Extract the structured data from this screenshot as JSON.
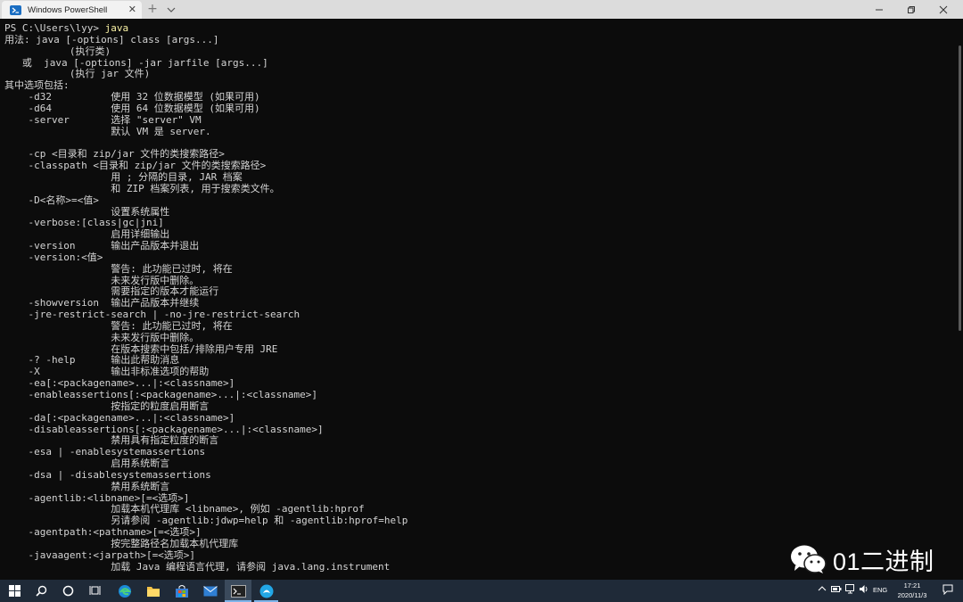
{
  "window": {
    "tab_title": "Windows PowerShell",
    "tab_close_glyph": "✕",
    "new_tab_glyph": "+",
    "icons": [
      "powershell-icon",
      "chevron-down-icon",
      "minimize-icon",
      "maximize-icon",
      "close-icon"
    ]
  },
  "terminal": {
    "prompt": "PS C:\\Users\\lyy> ",
    "command": "java",
    "lines": [
      "用法: java [-options] class [args...]",
      "           (执行类)",
      "   或  java [-options] -jar jarfile [args...]",
      "           (执行 jar 文件)",
      "其中选项包括:",
      "    -d32          使用 32 位数据模型 (如果可用)",
      "    -d64          使用 64 位数据模型 (如果可用)",
      "    -server       选择 \"server\" VM",
      "                  默认 VM 是 server.",
      "",
      "    -cp <目录和 zip/jar 文件的类搜索路径>",
      "    -classpath <目录和 zip/jar 文件的类搜索路径>",
      "                  用 ; 分隔的目录, JAR 档案",
      "                  和 ZIP 档案列表, 用于搜索类文件。",
      "    -D<名称>=<值>",
      "                  设置系统属性",
      "    -verbose:[class|gc|jni]",
      "                  启用详细输出",
      "    -version      输出产品版本并退出",
      "    -version:<值>",
      "                  警告: 此功能已过时, 将在",
      "                  未来发行版中删除。",
      "                  需要指定的版本才能运行",
      "    -showversion  输出产品版本并继续",
      "    -jre-restrict-search | -no-jre-restrict-search",
      "                  警告: 此功能已过时, 将在",
      "                  未来发行版中删除。",
      "                  在版本搜索中包括/排除用户专用 JRE",
      "    -? -help      输出此帮助消息",
      "    -X            输出非标准选项的帮助",
      "    -ea[:<packagename>...|:<classname>]",
      "    -enableassertions[:<packagename>...|:<classname>]",
      "                  按指定的粒度启用断言",
      "    -da[:<packagename>...|:<classname>]",
      "    -disableassertions[:<packagename>...|:<classname>]",
      "                  禁用具有指定粒度的断言",
      "    -esa | -enablesystemassertions",
      "                  启用系统断言",
      "    -dsa | -disablesystemassertions",
      "                  禁用系统断言",
      "    -agentlib:<libname>[=<选项>]",
      "                  加载本机代理库 <libname>, 例如 -agentlib:hprof",
      "                  另请参阅 -agentlib:jdwp=help 和 -agentlib:hprof=help",
      "    -agentpath:<pathname>[=<选项>]",
      "                  按完整路径名加载本机代理库",
      "    -javaagent:<jarpath>[=<选项>]",
      "                  加载 Java 编程语言代理, 请参阅 java.lang.instrument"
    ]
  },
  "watermark": {
    "text": "01二进制",
    "icon": "wechat-icon"
  },
  "taskbar": {
    "icons": [
      "windows-start-icon",
      "search-icon",
      "cortana-icon",
      "task-view-icon",
      "edge-icon",
      "file-explorer-icon",
      "store-icon",
      "mail-icon",
      "terminal-icon",
      "app-icon"
    ],
    "tray": {
      "language": "ENG",
      "time": "17:21",
      "date": "2020/11/3"
    },
    "colors": {
      "bar": "#1f2a38",
      "accent": "#7eb4ea"
    }
  }
}
